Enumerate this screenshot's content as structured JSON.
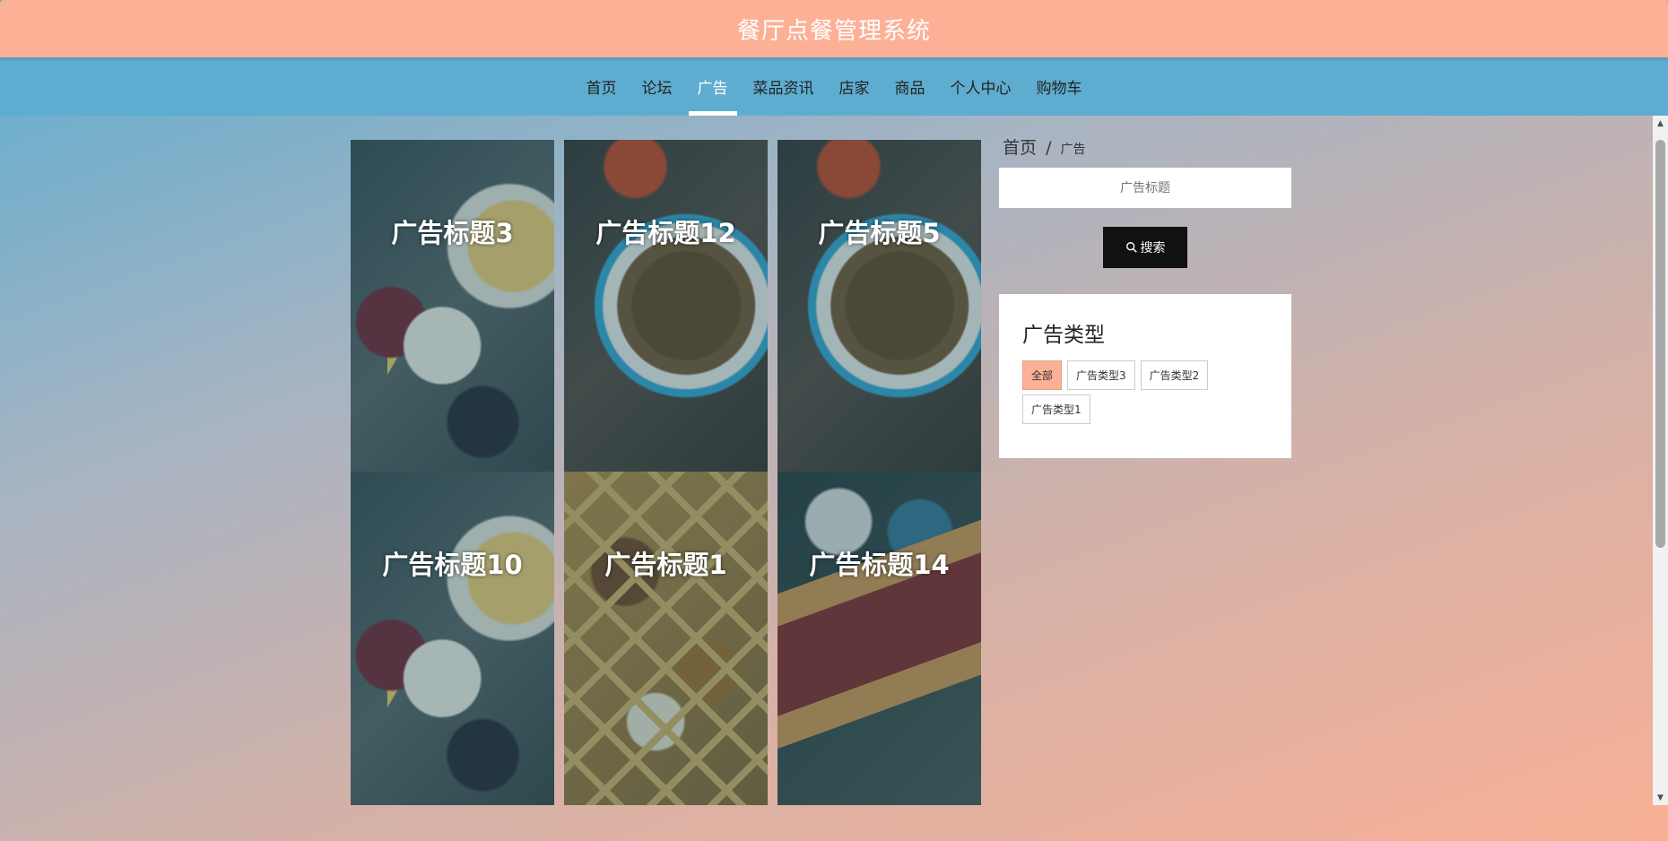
{
  "app": {
    "title": "餐厅点餐管理系统"
  },
  "nav": {
    "items": [
      {
        "label": "首页"
      },
      {
        "label": "论坛"
      },
      {
        "label": "广告"
      },
      {
        "label": "菜品资讯"
      },
      {
        "label": "店家"
      },
      {
        "label": "商品"
      },
      {
        "label": "个人中心"
      },
      {
        "label": "购物车"
      }
    ],
    "active": "广告"
  },
  "ads": [
    {
      "title": "广告标题3"
    },
    {
      "title": "广告标题12"
    },
    {
      "title": "广告标题5"
    },
    {
      "title": "广告标题10"
    },
    {
      "title": "广告标题1"
    },
    {
      "title": "广告标题14"
    }
  ],
  "breadcrumb": {
    "home": "首页",
    "separator": "/",
    "current": "广告"
  },
  "search": {
    "placeholder": "广告标题",
    "button_label": "搜索"
  },
  "type_panel": {
    "title": "广告类型",
    "tags": [
      {
        "label": "全部",
        "active": true
      },
      {
        "label": "广告类型3",
        "active": false
      },
      {
        "label": "广告类型2",
        "active": false
      },
      {
        "label": "广告类型1",
        "active": false
      }
    ]
  },
  "colors": {
    "accent": "#fcb197",
    "nav_bg": "#5eadd0",
    "button_bg": "#111111"
  }
}
